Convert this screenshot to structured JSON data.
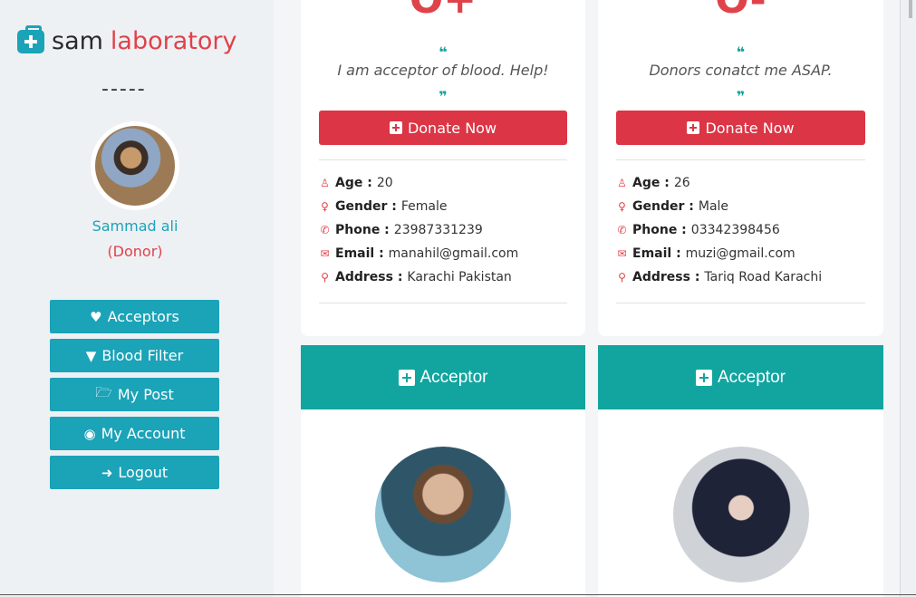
{
  "sidebar": {
    "brand_part1": "sam",
    "brand_part2": "laboratory",
    "divider": "-----",
    "user_name": "Sammad ali",
    "user_role": "(Donor)",
    "menu": [
      {
        "label": "Acceptors",
        "icon": "heartbeat-icon"
      },
      {
        "label": "Blood Filter",
        "icon": "filter-icon"
      },
      {
        "label": "My Post",
        "icon": "folder-open-icon"
      },
      {
        "label": "My Account",
        "icon": "user-circle-icon"
      },
      {
        "label": "Logout",
        "icon": "sign-out-icon"
      }
    ]
  },
  "cards": [
    {
      "blood_group": "O+",
      "quote_open": "❝",
      "quote_close": "❞",
      "message": "I am acceptor of blood. Help!",
      "donate_label": "Donate Now",
      "age_label": "Age :",
      "age": "20",
      "gender_label": "Gender :",
      "gender": "Female",
      "phone_label": "Phone :",
      "phone": "23987331239",
      "email_label": "Email :",
      "email": "manahil@gmail.com",
      "address_label": "Address :",
      "address": "Karachi Pakistan"
    },
    {
      "blood_group": "O-",
      "quote_open": "❝",
      "quote_close": "❞",
      "message": "Donors conatct me ASAP.",
      "donate_label": "Donate Now",
      "age_label": "Age :",
      "age": "26",
      "gender_label": "Gender :",
      "gender": "Male",
      "phone_label": "Phone :",
      "phone": "03342398456",
      "email_label": "Email :",
      "email": "muzi@gmail.com",
      "address_label": "Address :",
      "address": "Tariq Road Karachi"
    }
  ],
  "acceptor_cards": [
    {
      "title": "Acceptor",
      "name": ""
    },
    {
      "title": "Acceptor",
      "name": ""
    }
  ],
  "colors": {
    "accent": "#1ba3b8",
    "danger": "#dc3545",
    "teal": "#12a5a0"
  }
}
